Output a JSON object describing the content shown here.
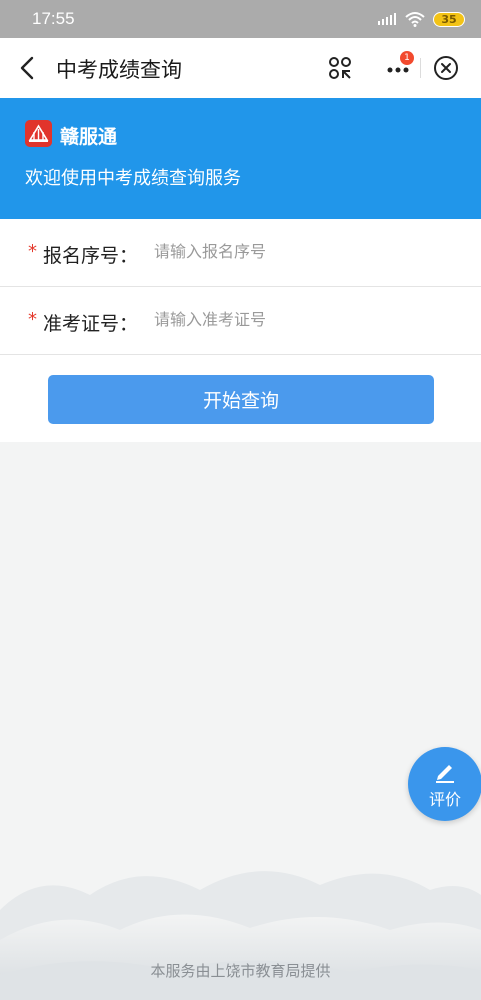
{
  "status_bar": {
    "time": "17:55",
    "battery": "35"
  },
  "nav": {
    "title": "中考成绩查询",
    "badge_count": "1"
  },
  "banner": {
    "brand_name": "赣服通",
    "welcome": "欢迎使用中考成绩查询服务",
    "background": "#2196ea"
  },
  "form": {
    "required_mark": "*",
    "fields": [
      {
        "label": "报名序号：",
        "placeholder": "请输入报名序号",
        "value": ""
      },
      {
        "label": "准考证号：",
        "placeholder": "请输入准考证号",
        "value": ""
      }
    ],
    "submit_label": "开始查询"
  },
  "fab": {
    "label": "评价",
    "icon": "pencil-icon"
  },
  "footer": {
    "text": "本服务由上饶市教育局提供"
  },
  "colors": {
    "accent": "#4b9aed",
    "required": "#e4392c",
    "badge": "#f24a2e"
  }
}
